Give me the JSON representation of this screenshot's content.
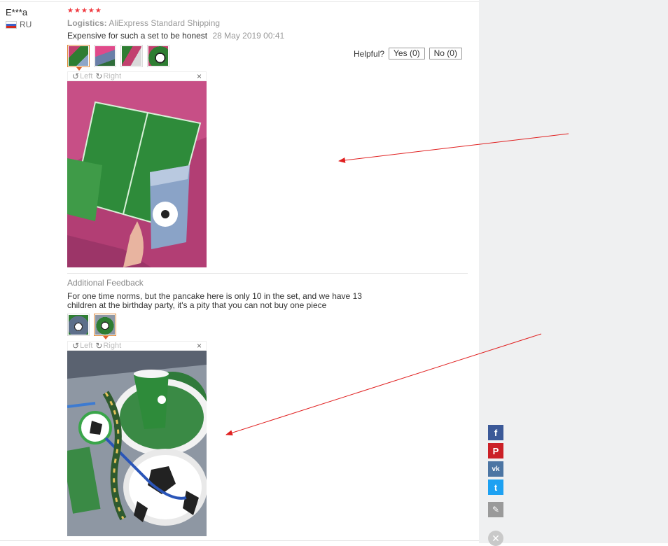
{
  "review": {
    "user_name": "E***a",
    "country": "RU",
    "rating": 5,
    "logistics_label": "Logistics:",
    "logistics_value": "AliExpress Standard Shipping",
    "text": "Expensive for such a set to be honest",
    "date": "28 May 2019 00:41"
  },
  "helpful": {
    "label": "Helpful?",
    "yes": "Yes (0)",
    "no": "No (0)"
  },
  "viewer": {
    "left_label": "Left",
    "right_label": "Right",
    "close": "×"
  },
  "additional": {
    "title": "Additional Feedback",
    "text": "For one time norms, but the pancake here is only 10 in the set, and we have 13 children at the birthday party, it's a pity that you can not buy one piece"
  },
  "social": {
    "facebook": "f",
    "pinterest": "P",
    "vk": "vk",
    "twitter": "t"
  },
  "colors": {
    "star": "#f0393f",
    "accent": "#e08a3a",
    "arrow": "#e02020",
    "facebook": "#3b5998",
    "pinterest": "#cb2027",
    "vk": "#4c75a3",
    "twitter": "#1da1f2"
  }
}
